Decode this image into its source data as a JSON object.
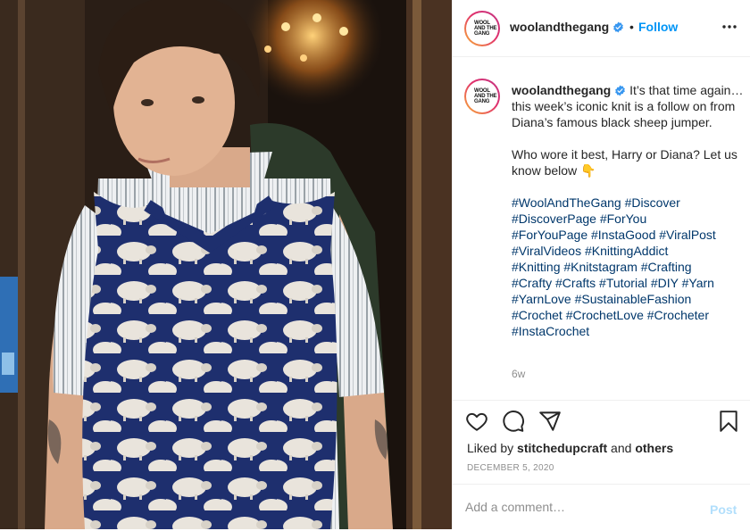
{
  "header": {
    "username": "woolandthegang",
    "separator": "•",
    "follow_label": "Follow",
    "avatar_logo_text": "WOOL\nAND THE\nGANG",
    "more_icon": "more-options-icon"
  },
  "caption": {
    "username": "woolandthegang",
    "body": " It’s that time again… this week’s iconic knit is a follow on from Diana’s famous black sheep jumper.\n\nWho wore it best, Harry or Diana? Let us know below 👇\n\n",
    "hashtags": "#WoolAndTheGang #Discover\n#DiscoverPage #ForYou\n#ForYouPage #InstaGood #ViralPost\n#ViralVideos #KnittingAddict\n#Knitting #Knitstagram #Crafting\n#Crafty #Crafts #Tutorial #DIY #Yarn\n#YarnLove #SustainableFashion\n#Crochet #CrochetLove #Crocheter\n#InstaCrochet",
    "time_ago": "6w"
  },
  "actions": {
    "icons": [
      "heart-icon",
      "comment-icon",
      "share-icon",
      "bookmark-icon"
    ],
    "liked_prefix": "Liked by ",
    "liked_user": "stitchedupcraft",
    "liked_middle": " and ",
    "liked_others": "others",
    "date": "DECEMBER 5, 2020"
  },
  "comment": {
    "placeholder": "Add a comment…",
    "post_label": "Post"
  },
  "colors": {
    "link_blue": "#0095f6",
    "hashtag_blue": "#00376b",
    "muted": "#8e8e8e",
    "post_disabled": "#b2dffc"
  }
}
